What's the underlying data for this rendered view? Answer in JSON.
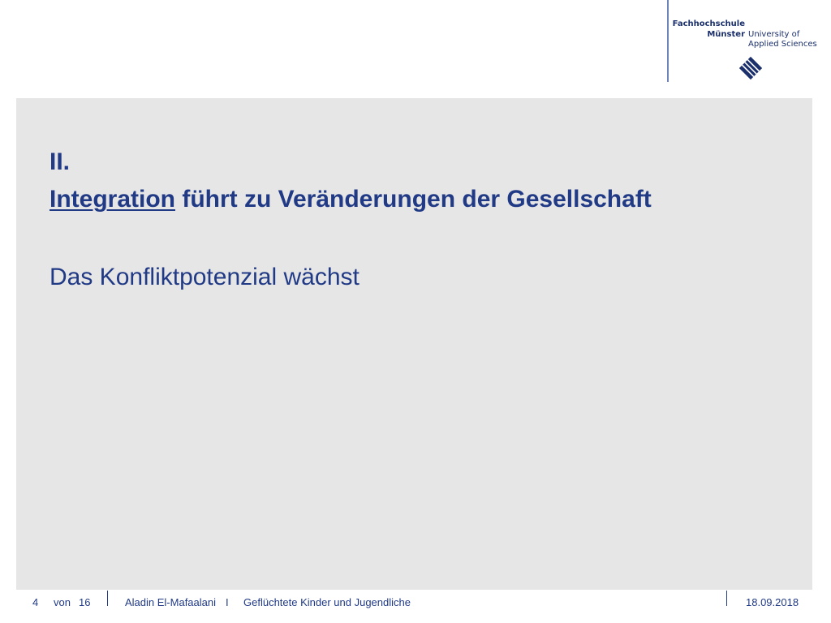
{
  "logo": {
    "line1": "Fachhochschule",
    "line2": "Münster",
    "line3": "University of",
    "line4": "Applied Sciences",
    "mark_icon": "fh-muenster-logo-mark"
  },
  "slide": {
    "section": "II.",
    "heading_highlight": "Integration",
    "heading_rest": " führt zu Veränderungen der Gesellschaft",
    "subheading": "Das Konfliktpotenzial wächst"
  },
  "footer": {
    "page": "4",
    "of_label": "von",
    "total": "16",
    "author": "Aladin El-Mafaalani",
    "sep_char": "I",
    "title": "Geflüchtete Kinder und Jugendliche",
    "date": "18.09.2018"
  },
  "colors": {
    "brand_blue": "#213a86",
    "panel_gray": "#e6e6e6"
  }
}
